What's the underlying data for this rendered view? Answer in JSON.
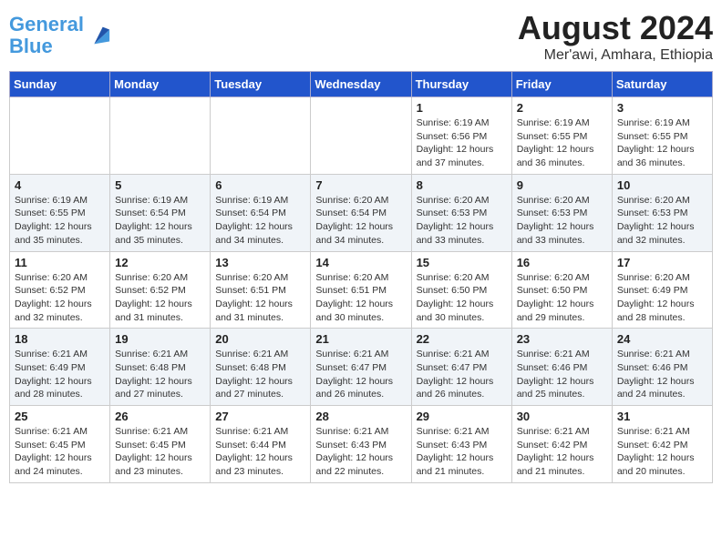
{
  "header": {
    "logo_line1": "General",
    "logo_line2": "Blue",
    "title": "August 2024",
    "subtitle": "Mer'awi, Amhara, Ethiopia"
  },
  "days_of_week": [
    "Sunday",
    "Monday",
    "Tuesday",
    "Wednesday",
    "Thursday",
    "Friday",
    "Saturday"
  ],
  "weeks": [
    [
      {
        "day": "",
        "info": ""
      },
      {
        "day": "",
        "info": ""
      },
      {
        "day": "",
        "info": ""
      },
      {
        "day": "",
        "info": ""
      },
      {
        "day": "1",
        "info": "Sunrise: 6:19 AM\nSunset: 6:56 PM\nDaylight: 12 hours\nand 37 minutes."
      },
      {
        "day": "2",
        "info": "Sunrise: 6:19 AM\nSunset: 6:55 PM\nDaylight: 12 hours\nand 36 minutes."
      },
      {
        "day": "3",
        "info": "Sunrise: 6:19 AM\nSunset: 6:55 PM\nDaylight: 12 hours\nand 36 minutes."
      }
    ],
    [
      {
        "day": "4",
        "info": "Sunrise: 6:19 AM\nSunset: 6:55 PM\nDaylight: 12 hours\nand 35 minutes."
      },
      {
        "day": "5",
        "info": "Sunrise: 6:19 AM\nSunset: 6:54 PM\nDaylight: 12 hours\nand 35 minutes."
      },
      {
        "day": "6",
        "info": "Sunrise: 6:19 AM\nSunset: 6:54 PM\nDaylight: 12 hours\nand 34 minutes."
      },
      {
        "day": "7",
        "info": "Sunrise: 6:20 AM\nSunset: 6:54 PM\nDaylight: 12 hours\nand 34 minutes."
      },
      {
        "day": "8",
        "info": "Sunrise: 6:20 AM\nSunset: 6:53 PM\nDaylight: 12 hours\nand 33 minutes."
      },
      {
        "day": "9",
        "info": "Sunrise: 6:20 AM\nSunset: 6:53 PM\nDaylight: 12 hours\nand 33 minutes."
      },
      {
        "day": "10",
        "info": "Sunrise: 6:20 AM\nSunset: 6:53 PM\nDaylight: 12 hours\nand 32 minutes."
      }
    ],
    [
      {
        "day": "11",
        "info": "Sunrise: 6:20 AM\nSunset: 6:52 PM\nDaylight: 12 hours\nand 32 minutes."
      },
      {
        "day": "12",
        "info": "Sunrise: 6:20 AM\nSunset: 6:52 PM\nDaylight: 12 hours\nand 31 minutes."
      },
      {
        "day": "13",
        "info": "Sunrise: 6:20 AM\nSunset: 6:51 PM\nDaylight: 12 hours\nand 31 minutes."
      },
      {
        "day": "14",
        "info": "Sunrise: 6:20 AM\nSunset: 6:51 PM\nDaylight: 12 hours\nand 30 minutes."
      },
      {
        "day": "15",
        "info": "Sunrise: 6:20 AM\nSunset: 6:50 PM\nDaylight: 12 hours\nand 30 minutes."
      },
      {
        "day": "16",
        "info": "Sunrise: 6:20 AM\nSunset: 6:50 PM\nDaylight: 12 hours\nand 29 minutes."
      },
      {
        "day": "17",
        "info": "Sunrise: 6:20 AM\nSunset: 6:49 PM\nDaylight: 12 hours\nand 28 minutes."
      }
    ],
    [
      {
        "day": "18",
        "info": "Sunrise: 6:21 AM\nSunset: 6:49 PM\nDaylight: 12 hours\nand 28 minutes."
      },
      {
        "day": "19",
        "info": "Sunrise: 6:21 AM\nSunset: 6:48 PM\nDaylight: 12 hours\nand 27 minutes."
      },
      {
        "day": "20",
        "info": "Sunrise: 6:21 AM\nSunset: 6:48 PM\nDaylight: 12 hours\nand 27 minutes."
      },
      {
        "day": "21",
        "info": "Sunrise: 6:21 AM\nSunset: 6:47 PM\nDaylight: 12 hours\nand 26 minutes."
      },
      {
        "day": "22",
        "info": "Sunrise: 6:21 AM\nSunset: 6:47 PM\nDaylight: 12 hours\nand 26 minutes."
      },
      {
        "day": "23",
        "info": "Sunrise: 6:21 AM\nSunset: 6:46 PM\nDaylight: 12 hours\nand 25 minutes."
      },
      {
        "day": "24",
        "info": "Sunrise: 6:21 AM\nSunset: 6:46 PM\nDaylight: 12 hours\nand 24 minutes."
      }
    ],
    [
      {
        "day": "25",
        "info": "Sunrise: 6:21 AM\nSunset: 6:45 PM\nDaylight: 12 hours\nand 24 minutes."
      },
      {
        "day": "26",
        "info": "Sunrise: 6:21 AM\nSunset: 6:45 PM\nDaylight: 12 hours\nand 23 minutes."
      },
      {
        "day": "27",
        "info": "Sunrise: 6:21 AM\nSunset: 6:44 PM\nDaylight: 12 hours\nand 23 minutes."
      },
      {
        "day": "28",
        "info": "Sunrise: 6:21 AM\nSunset: 6:43 PM\nDaylight: 12 hours\nand 22 minutes."
      },
      {
        "day": "29",
        "info": "Sunrise: 6:21 AM\nSunset: 6:43 PM\nDaylight: 12 hours\nand 21 minutes."
      },
      {
        "day": "30",
        "info": "Sunrise: 6:21 AM\nSunset: 6:42 PM\nDaylight: 12 hours\nand 21 minutes."
      },
      {
        "day": "31",
        "info": "Sunrise: 6:21 AM\nSunset: 6:42 PM\nDaylight: 12 hours\nand 20 minutes."
      }
    ]
  ]
}
